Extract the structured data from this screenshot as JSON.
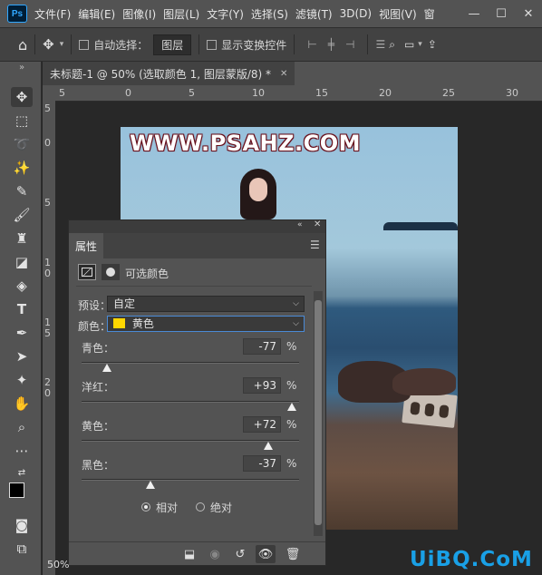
{
  "app": {
    "logo": "Ps"
  },
  "menu": [
    "文件(F)",
    "编辑(E)",
    "图像(I)",
    "图层(L)",
    "文字(Y)",
    "选择(S)",
    "滤镜(T)",
    "3D(D)",
    "视图(V)",
    "窗"
  ],
  "window_controls": [
    "—",
    "☐",
    "✕"
  ],
  "options": {
    "auto_select_label": "自动选择：",
    "auto_select_target": "图层",
    "show_transform_label": "显示变换控件"
  },
  "document": {
    "tab_title": "未标题-1 @ 50% (选取颜色 1, 图层蒙版/8) *",
    "close": "✕",
    "zoom": "50%"
  },
  "rulers": {
    "top": [
      "5",
      "0",
      "5",
      "10",
      "15",
      "20",
      "25"
    ],
    "left": [
      "5",
      "0",
      "5",
      "1 0",
      "1 5",
      "2 0"
    ]
  },
  "canvas": {
    "watermark": "WWW.PSAHZ.COM"
  },
  "panel": {
    "tab": "属性",
    "adjustment_title": "可选颜色",
    "preset_label": "预设：",
    "preset_value": "自定",
    "colors_label": "颜色：",
    "colors_value": "黄色",
    "colors_swatch": "#ffd700",
    "sliders": [
      {
        "label": "青色：",
        "value": "-77",
        "unit": "%",
        "level": -77
      },
      {
        "label": "洋红：",
        "value": "+93",
        "unit": "%",
        "level": 93
      },
      {
        "label": "黄色：",
        "value": "+72",
        "unit": "%",
        "level": 72
      },
      {
        "label": "黑色：",
        "value": "-37",
        "unit": "%",
        "level": -37
      }
    ],
    "method_relative": "相对",
    "method_absolute": "绝对",
    "method_selected": "relative"
  },
  "site_logo": "UiBQ.CoM"
}
